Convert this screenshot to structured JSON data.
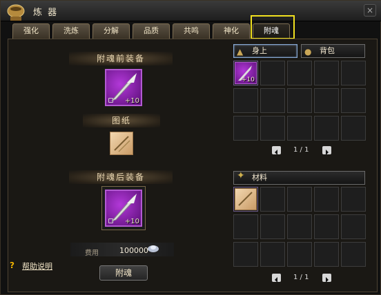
{
  "window": {
    "title": "炼 器"
  },
  "tabs": [
    "强化",
    "洗炼",
    "分解",
    "品质",
    "共鸣",
    "神化",
    "附魂"
  ],
  "active_tab": "附魂",
  "left": {
    "before_label": "附魂前装备",
    "scroll_label": "图纸",
    "after_label": "附魂后装备",
    "before_item_plus": "+10",
    "after_item_plus": "+10",
    "cost_label": "费用",
    "cost_value": "100000",
    "help_icon": "?",
    "help_text": "帮助说明",
    "attach_button": "附魂"
  },
  "right": {
    "equip_tab": "身上",
    "bag_tab": "背包",
    "equip_pager": "1 / 1",
    "material_label": "材料",
    "material_pager": "1 / 1",
    "equip_grid_item_plus": "+10"
  },
  "colors": {
    "highlight": "#f2e11f",
    "item_purple": "#b238d8"
  }
}
